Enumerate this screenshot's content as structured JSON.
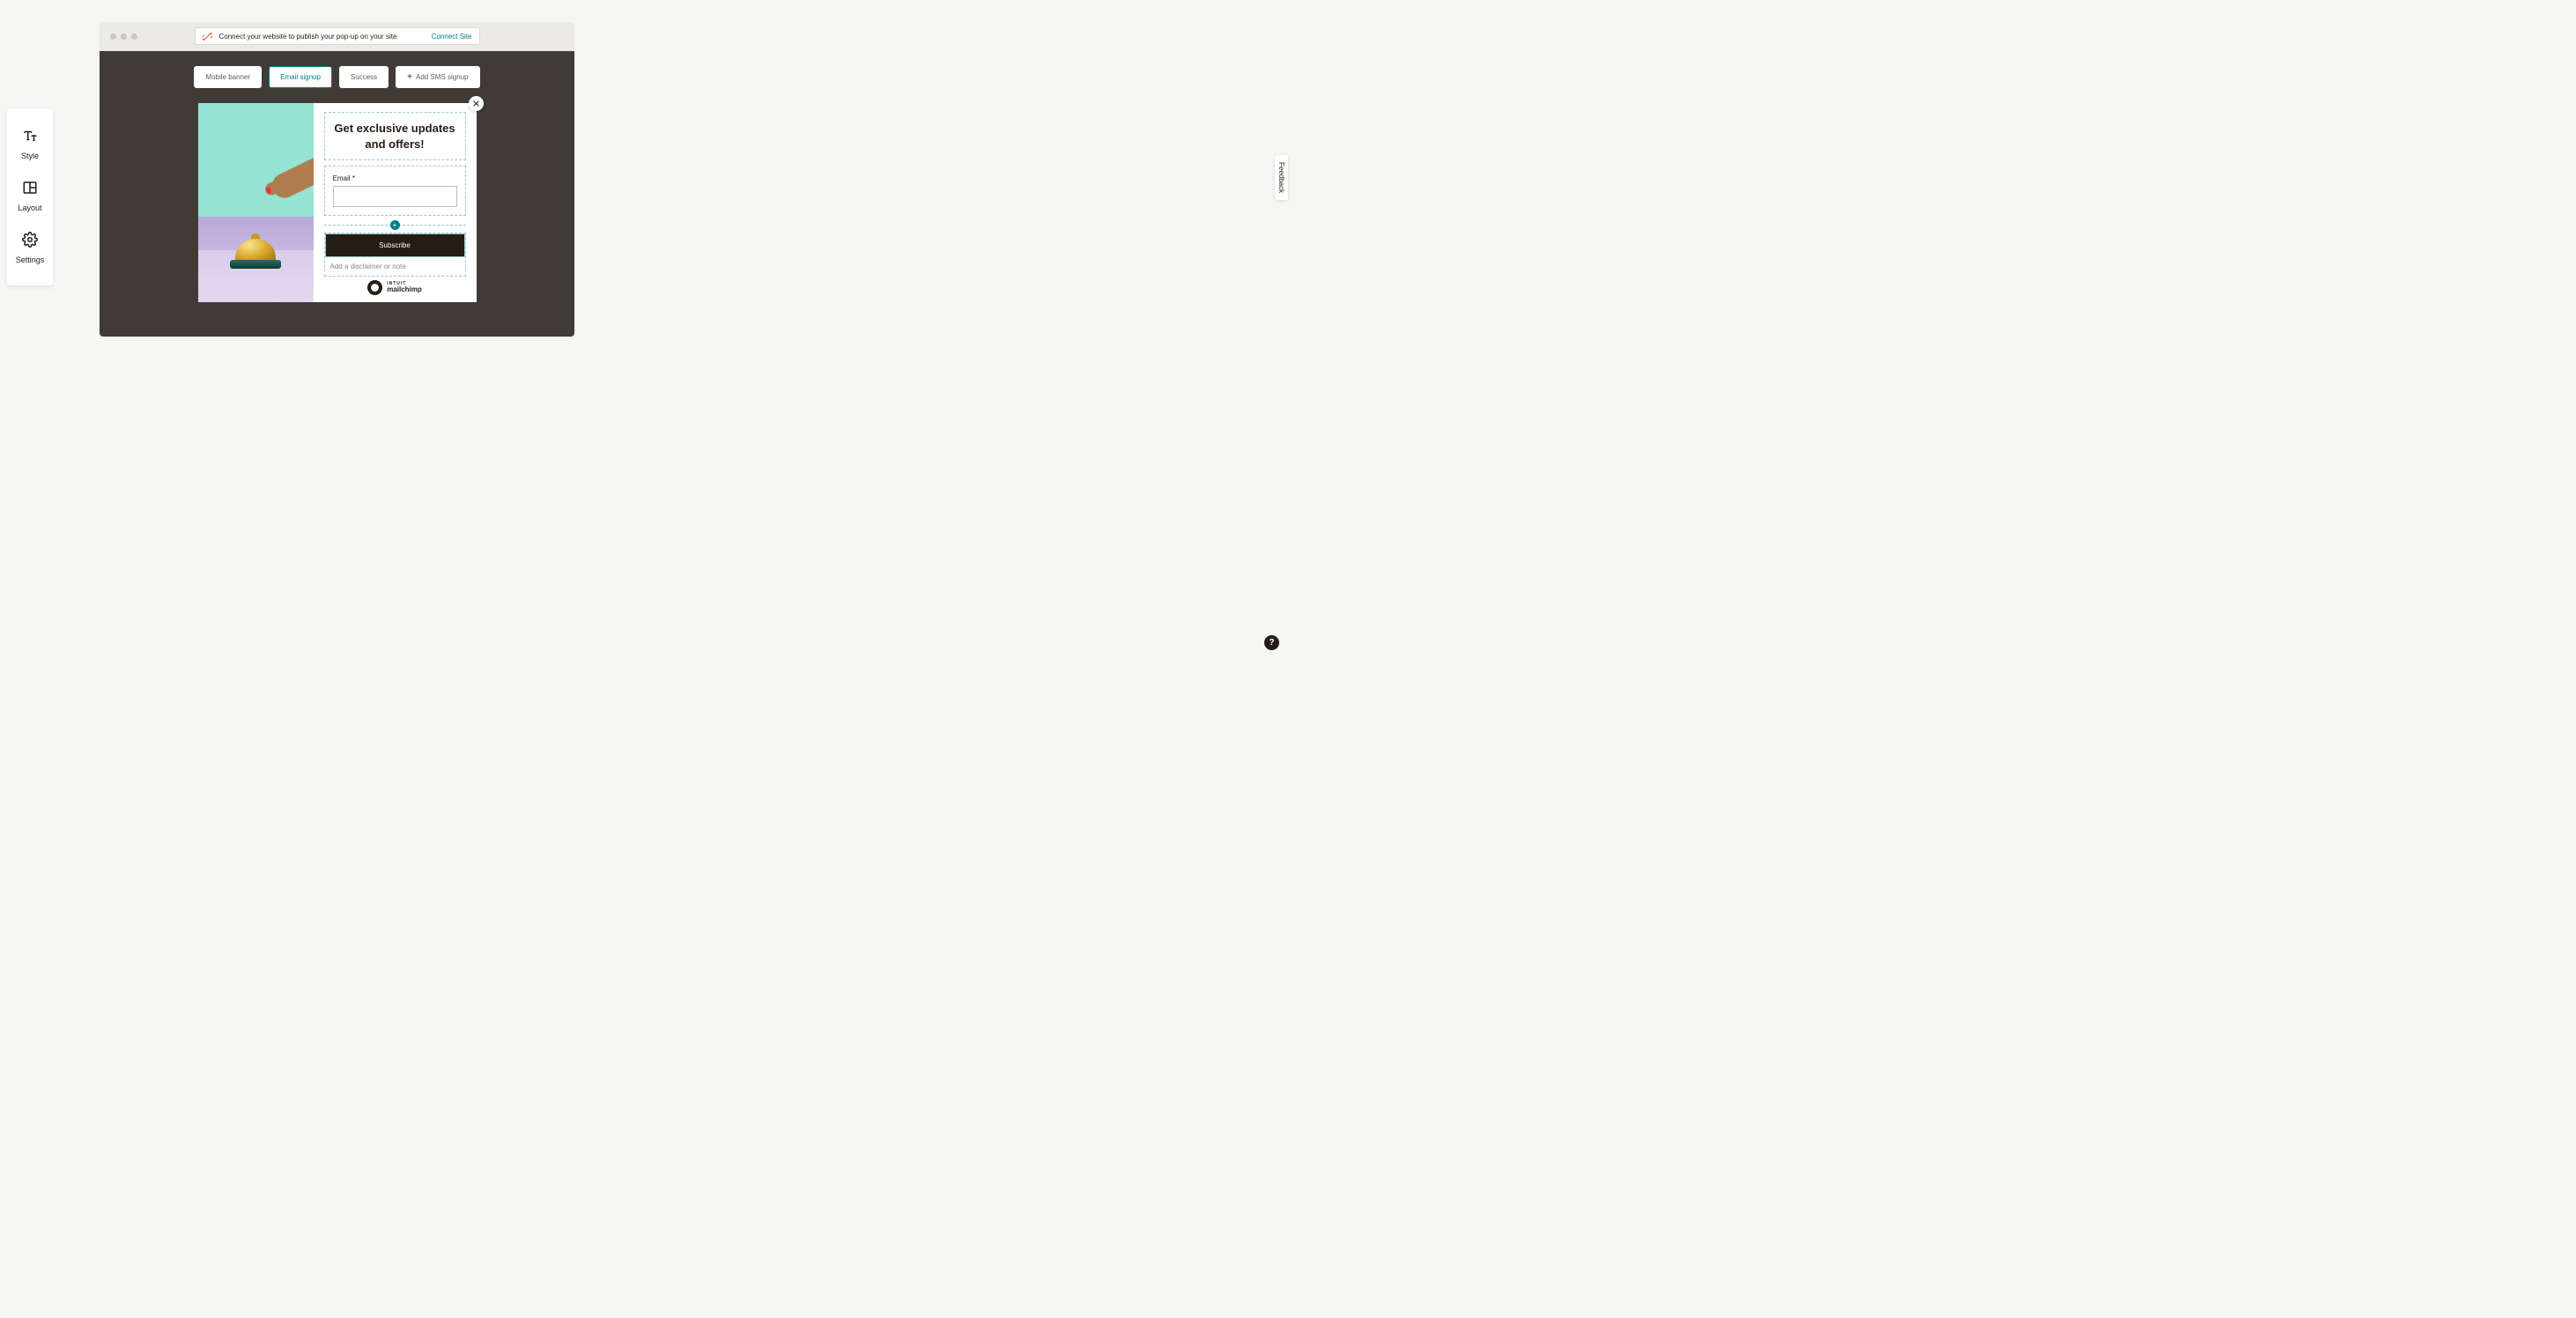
{
  "sidebar": {
    "items": [
      {
        "label": "Style",
        "icon": "text-style-icon"
      },
      {
        "label": "Layout",
        "icon": "layout-icon"
      },
      {
        "label": "Settings",
        "icon": "gear-icon"
      }
    ]
  },
  "connect_banner": {
    "message": "Connect your website to publish your pop-up on your site",
    "cta": "Connect Site"
  },
  "tabs": [
    {
      "label": "Mobile banner",
      "active": false
    },
    {
      "label": "Email signup",
      "active": true
    },
    {
      "label": "Success",
      "active": false
    },
    {
      "label": "Add SMS signup",
      "active": false,
      "has_plus": true
    }
  ],
  "popup": {
    "headline": "Get exclusive updates and offers!",
    "email_label": "Email *",
    "subscribe_label": "Subscribe",
    "disclaimer_placeholder": "Add a disclaimer or note",
    "brand_top": "INTUIT",
    "brand_bottom": "mailchimp"
  },
  "feedback_label": "Feedback",
  "help_label": "?"
}
